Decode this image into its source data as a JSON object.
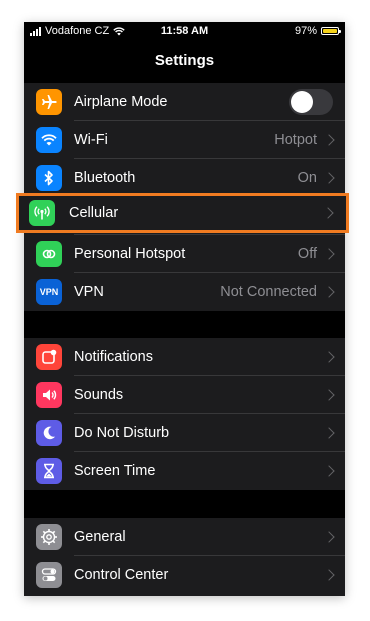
{
  "status_bar": {
    "carrier": "Vodafone CZ",
    "time": "11:58 AM",
    "battery": "97%",
    "battery_level": 0.97
  },
  "nav": {
    "title": "Settings"
  },
  "group1": [
    {
      "id": "airplane",
      "label": "Airplane Mode",
      "value": "",
      "icon": "airplane-icon",
      "color": "#ff9500",
      "toggle": true,
      "toggle_on": false
    },
    {
      "id": "wifi",
      "label": "Wi-Fi",
      "value": "Hotpot",
      "icon": "wifi-icon",
      "color": "#0a84ff"
    },
    {
      "id": "bluetooth",
      "label": "Bluetooth",
      "value": "On",
      "icon": "bluetooth-icon",
      "color": "#0a84ff"
    },
    {
      "id": "cellular",
      "label": "Cellular",
      "value": "",
      "icon": "antenna-icon",
      "color": "#30d158",
      "highlighted": true
    },
    {
      "id": "hotspot",
      "label": "Personal Hotspot",
      "value": "Off",
      "icon": "hotspot-icon",
      "color": "#30d158"
    },
    {
      "id": "vpn",
      "label": "VPN",
      "value": "Not Connected",
      "icon": "vpn-icon",
      "icon_text": "VPN",
      "color": "#0a62d6"
    }
  ],
  "group2": [
    {
      "id": "notifications",
      "label": "Notifications",
      "icon": "notifications-icon",
      "color": "#ff453a"
    },
    {
      "id": "sounds",
      "label": "Sounds",
      "icon": "speaker-icon",
      "color": "#ff375f"
    },
    {
      "id": "dnd",
      "label": "Do Not Disturb",
      "icon": "moon-icon",
      "color": "#5e5ce6"
    },
    {
      "id": "screentime",
      "label": "Screen Time",
      "icon": "hourglass-icon",
      "color": "#5e5ce6"
    }
  ],
  "group3": [
    {
      "id": "general",
      "label": "General",
      "icon": "gear-icon",
      "color": "#8e8e93"
    },
    {
      "id": "controlcenter",
      "label": "Control Center",
      "icon": "toggles-icon",
      "color": "#8e8e93"
    }
  ],
  "highlight_color": "#f07b21"
}
